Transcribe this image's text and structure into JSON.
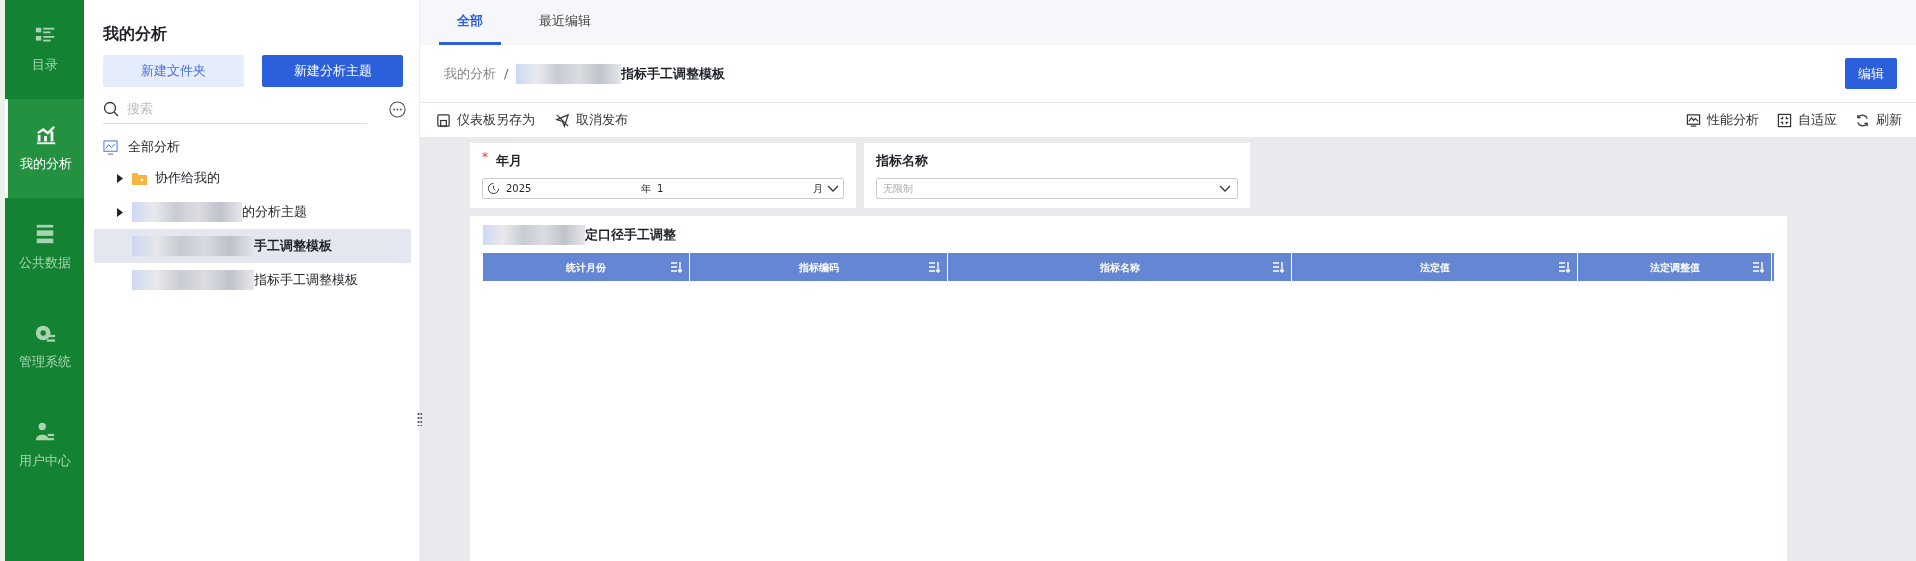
{
  "nav": [
    {
      "label": "目录",
      "kind": "catalog",
      "selected": false
    },
    {
      "label": "我的分析",
      "kind": "analysis",
      "selected": true
    },
    {
      "label": "公共数据",
      "kind": "data",
      "selected": false
    },
    {
      "label": "管理系统",
      "kind": "gear",
      "selected": false
    },
    {
      "label": "用户中心",
      "kind": "user",
      "selected": false
    }
  ],
  "sidebar": {
    "title": "我的分析",
    "buttons": [
      {
        "label": "新建文件夹",
        "kind": "secondary"
      },
      {
        "label": "新建分析主题",
        "kind": "primary"
      }
    ],
    "search": {
      "placeholder": "搜索"
    },
    "tree": {
      "label": "全部分析",
      "children": [
        {
          "label": "协作给我的",
          "kind": "folder",
          "expanded": false,
          "redacted": false,
          "selected": false
        },
        {
          "label": "的分析主题",
          "kind": "folder",
          "expanded": false,
          "redacted": true,
          "selected": false
        },
        {
          "label": "手工调整模板",
          "kind": "file",
          "redacted": true,
          "selected": true
        },
        {
          "label": "指标手工调整模板",
          "kind": "file",
          "redacted": true,
          "selected": false
        }
      ]
    }
  },
  "tabs": [
    {
      "label": "全部",
      "selected": true
    },
    {
      "label": "最近编辑",
      "selected": false
    }
  ],
  "breadcrumb": {
    "root": "我的分析",
    "separator": "/",
    "current": "指标手工调整模板",
    "redacted": true
  },
  "edit_button": "编辑",
  "toolbar_left": [
    {
      "label": "仪表板另存为",
      "kind": "save"
    },
    {
      "label": "取消发布",
      "kind": "unpublish"
    }
  ],
  "toolbar_right": [
    {
      "label": "性能分析",
      "kind": "monitor"
    },
    {
      "label": "自适应",
      "kind": "fit"
    },
    {
      "label": "刷新",
      "kind": "refresh"
    }
  ],
  "filters": [
    {
      "label": "年月",
      "required": true,
      "required_mark": "*",
      "kind": "month",
      "year": "2025",
      "year_unit": "年",
      "month": "1",
      "month_unit": "月"
    },
    {
      "label": "指标名称",
      "required": false,
      "kind": "select",
      "placeholder": "无限制"
    }
  ],
  "table": {
    "title": "定口径手工调整",
    "title_redacted": true,
    "columns": [
      "统计月份",
      "指标编码",
      "指标名称",
      "法定值",
      "法定调整值"
    ]
  }
}
